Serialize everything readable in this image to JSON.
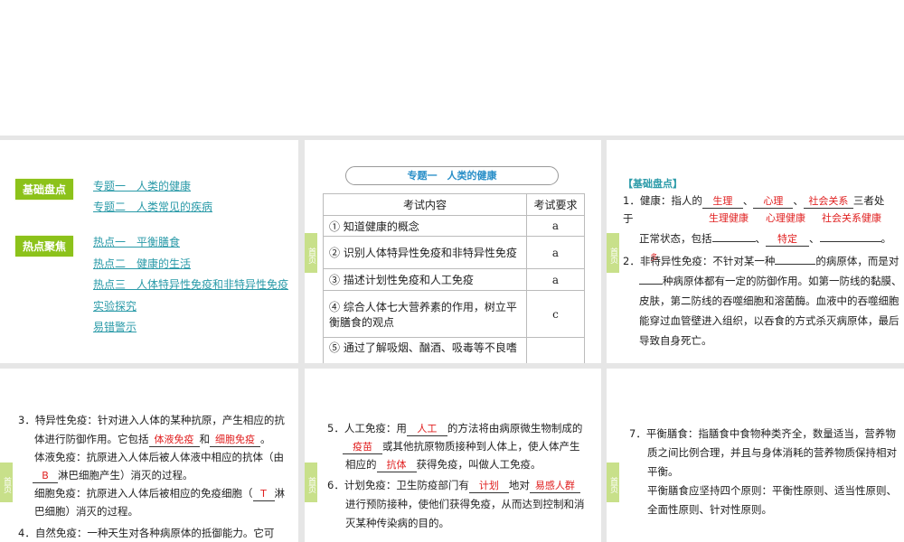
{
  "slide1": {
    "tag1": "基础盘点",
    "links1": [
      "专题一　人类的健康",
      "专题二　人类常见的疾病"
    ],
    "tag2": "热点聚焦",
    "links2": [
      "热点一　平衡膳食",
      "热点二　健康的生活",
      "热点三　人体特异性免疫和非特异性免疫",
      "实验探究",
      "易错警示"
    ]
  },
  "home_label": "首页",
  "slide2": {
    "title": "专题一　人类的健康",
    "headers": [
      "考试内容",
      "考试要求"
    ],
    "rows": [
      [
        "① 知道健康的概念",
        "a"
      ],
      [
        "② 识别人体特异性免疫和非特异性免疫",
        "a"
      ],
      [
        "③ 描述计划性免疫和人工免疫",
        "a"
      ],
      [
        "④ 综合人体七大营养素的作用，树立平衡膳食的观点",
        "c"
      ],
      [
        "⑤ 通过了解吸烟、酗酒、吸毒等不良嗜",
        ""
      ]
    ]
  },
  "slide3": {
    "heading": "【基础盘点】",
    "l1a": "1．健康：指人的",
    "a1": "生理",
    "sep1": "、",
    "a2": "心理",
    "sep2": "、",
    "a3": "社会关系",
    "l1b": "三者处",
    "l2": "于",
    "a4": "生理健康",
    "a5": "心理健康",
    "a6": "社会关系健康",
    "l3a": "正常状态，包括",
    "sep3": "、",
    "a7": "特定",
    "sep4": "、",
    "end3": "。",
    "l4a": "2．非特异性免疫：不针对某一种",
    "a8": "多",
    "l4b": "的病原体，而是对",
    "l5": "种病原体都有一定的防御作用。如第一防线的黏膜、",
    "l6": "皮肤，第二防线的吞噬细胞和溶菌酶。血液中的吞噬细胞",
    "l7": "能穿过血管壁进入组织，以吞食的方式杀灭病原体，最后",
    "l8": "导致自身死亡。"
  },
  "slide4": {
    "l1": "3．特异性免疫：针对进入人体的某种抗原，产生相应的抗",
    "l2a": "体进行防御作用。它包括",
    "a1": "体液免疫",
    "l2b": "和",
    "a2": "细胞免疫",
    "l2c": "。",
    "l3": "体液免疫：抗原进入人体后被人体液中相应的抗体（由",
    "a3": "B",
    "l4": "淋巴细胞产生）消灭的过程。",
    "l5a": "细胞免疫：抗原进入人体后被相应的免疫细胞（",
    "a4": "T",
    "l5b": "淋",
    "l6": "巴细胞）消灭的过程。",
    "l7": "4．自然免疫：一种天生对各种病原体的抵御能力。它可"
  },
  "slide5": {
    "l1a": "5．人工免疫：用",
    "a1": "人工",
    "l1b": "的方法将由病原微生物制成的",
    "a2": "疫苗",
    "l2b": "或其他抗原物质接种到人体上，使人体产生",
    "l3a": "相应的",
    "a3": "抗体",
    "l3b": "获得免疫，叫做人工免疫。",
    "l4a": "6．计划免疫：卫生防疫部门有",
    "a4": "计划",
    "l4b": "地对",
    "a5": "易感人群",
    "l5": "进行预防接种，使他们获得免疫，从而达到控制和消",
    "l6": "灭某种传染病的目的。"
  },
  "slide6": {
    "l1": "7．平衡膳食：指膳食中食物种类齐全，数量适当，营养物",
    "l2": "质之间比例合理，并且与身体消耗的营养物质保持相对",
    "l3": "平衡。",
    "l4": "平衡膳食应坚持四个原则：平衡性原则、适当性原则、",
    "l5": "全面性原则、针对性原则。"
  }
}
